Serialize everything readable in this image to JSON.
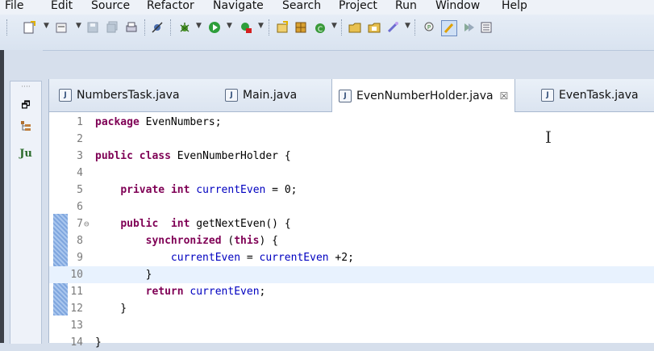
{
  "menu": [
    "File",
    "Edit",
    "Source",
    "Refactor",
    "Navigate",
    "Search",
    "Project",
    "Run",
    "Window",
    "Help"
  ],
  "toolbar_icons": [
    "new-icon",
    "new-package-icon",
    "save-icon",
    "save-all-icon",
    "print-icon",
    "skip-breakpoints-icon",
    "debug-icon",
    "run-icon",
    "run-external-icon",
    "new-java-project-icon",
    "new-package-icon",
    "new-class-icon",
    "open-type-icon",
    "open-task-icon",
    "search-icon",
    "outline-icon",
    "mark-occurrences-icon",
    "next-annotation-icon",
    "prev-annotation-icon"
  ],
  "left_panel_icons": [
    "restore-icon",
    "package-explorer-icon",
    "junit-icon"
  ],
  "left_panel_junit": "Ju",
  "tabs": [
    {
      "label": "NumbersTask.java",
      "active": false
    },
    {
      "label": "Main.java",
      "active": false
    },
    {
      "label": "EvenNumberHolder.java",
      "active": true,
      "close": "☒"
    },
    {
      "label": "EvenTask.java",
      "active": false
    }
  ],
  "lines": [
    {
      "n": "1",
      "parts": [
        {
          "t": "package",
          "k": "kw"
        },
        {
          "t": " EvenNumbers;",
          "k": ""
        }
      ]
    },
    {
      "n": "2",
      "parts": []
    },
    {
      "n": "3",
      "parts": [
        {
          "t": "public",
          "k": "kw"
        },
        {
          "t": " ",
          "k": ""
        },
        {
          "t": "class",
          "k": "kw"
        },
        {
          "t": " EvenNumberHolder {",
          "k": ""
        }
      ]
    },
    {
      "n": "4",
      "parts": []
    },
    {
      "n": "5",
      "parts": [
        {
          "t": "    ",
          "k": ""
        },
        {
          "t": "private",
          "k": "kw"
        },
        {
          "t": " ",
          "k": ""
        },
        {
          "t": "int",
          "k": "kw"
        },
        {
          "t": " ",
          "k": ""
        },
        {
          "t": "currentEven",
          "k": "fld"
        },
        {
          "t": " = 0;",
          "k": ""
        }
      ]
    },
    {
      "n": "6",
      "parts": []
    },
    {
      "n": "7",
      "fold": "⊖",
      "parts": [
        {
          "t": "    ",
          "k": ""
        },
        {
          "t": "public",
          "k": "kw"
        },
        {
          "t": "  ",
          "k": ""
        },
        {
          "t": "int",
          "k": "kw"
        },
        {
          "t": " getNextEven() {",
          "k": ""
        }
      ]
    },
    {
      "n": "8",
      "parts": [
        {
          "t": "        ",
          "k": ""
        },
        {
          "t": "synchronized",
          "k": "kw"
        },
        {
          "t": " (",
          "k": ""
        },
        {
          "t": "this",
          "k": "kw"
        },
        {
          "t": ") {",
          "k": ""
        }
      ]
    },
    {
      "n": "9",
      "parts": [
        {
          "t": "            ",
          "k": ""
        },
        {
          "t": "currentEven",
          "k": "fld"
        },
        {
          "t": " = ",
          "k": ""
        },
        {
          "t": "currentEven",
          "k": "fld"
        },
        {
          "t": " +2;",
          "k": ""
        }
      ]
    },
    {
      "n": "10",
      "current": true,
      "parts": [
        {
          "t": "        }",
          "k": ""
        }
      ]
    },
    {
      "n": "11",
      "parts": [
        {
          "t": "        ",
          "k": ""
        },
        {
          "t": "return",
          "k": "kw"
        },
        {
          "t": " ",
          "k": ""
        },
        {
          "t": "currentEven",
          "k": "fld"
        },
        {
          "t": ";",
          "k": ""
        }
      ]
    },
    {
      "n": "12",
      "parts": [
        {
          "t": "    }",
          "k": ""
        }
      ]
    },
    {
      "n": "13",
      "parts": []
    },
    {
      "n": "14",
      "parts": [
        {
          "t": "}",
          "k": ""
        }
      ]
    }
  ],
  "colors": {
    "keyword": "#7f0055",
    "field": "#0000c0",
    "current_line": "#e8f2fe"
  }
}
